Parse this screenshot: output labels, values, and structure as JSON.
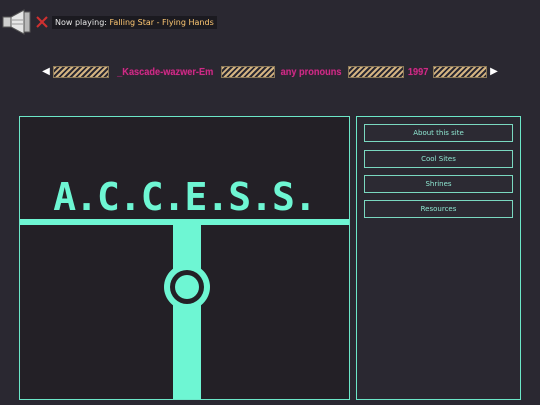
{
  "player": {
    "now_playing_label": "Now playing: ",
    "track": "Falling Star - Flying Hands"
  },
  "ribbon": {
    "left_arrow": "◀",
    "right_arrow": "▶",
    "name": "_Kascade-wazwer-Em",
    "pronouns": "any pronouns",
    "year": "1997"
  },
  "logo": {
    "text": "A.C.C.E.S.S."
  },
  "sidebar": {
    "items": [
      {
        "label": "About this site"
      },
      {
        "label": "Cool Sites"
      },
      {
        "label": "Shrines"
      },
      {
        "label": "Resources"
      }
    ]
  },
  "colors": {
    "background": "#2a2831",
    "accent": "#6ef6d3",
    "ribbon_text": "#cc2c86",
    "track_text": "#ffc873"
  },
  "icons": [
    "speaker-icon",
    "mute-x-icon",
    "left-arrow-icon",
    "right-arrow-icon"
  ]
}
